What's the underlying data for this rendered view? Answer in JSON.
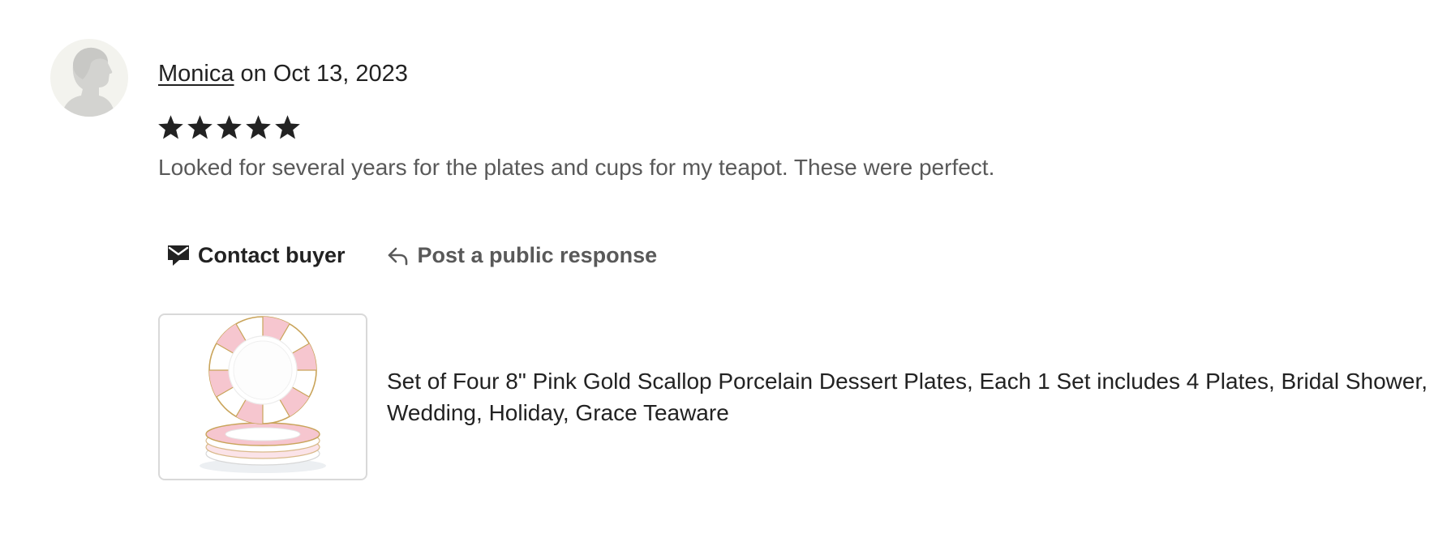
{
  "review": {
    "reviewer_name": "Monica",
    "date_text": " on Oct 13, 2023",
    "rating": 5,
    "rating_max": 5,
    "text": "Looked for several years for the plates and cups for my teapot. These were perfect."
  },
  "actions": {
    "contact_label": "Contact buyer",
    "respond_label": "Post a public response"
  },
  "product": {
    "title": "Set of Four 8\" Pink Gold Scallop Porcelain Dessert Plates, Each 1 Set includes 4 Plates, Bridal Shower, Wedding, Holiday, Grace Teaware"
  },
  "icons": {
    "avatar": "default-person-avatar",
    "star": "star-icon",
    "contact": "envelope-chat-icon",
    "respond": "reply-arrow-icon"
  },
  "colors": {
    "text_primary": "#222222",
    "text_secondary": "#595959",
    "avatar_bg": "#f3f3ee",
    "plate_pink": "#f6c6cf",
    "plate_gold": "#c9a45a"
  }
}
